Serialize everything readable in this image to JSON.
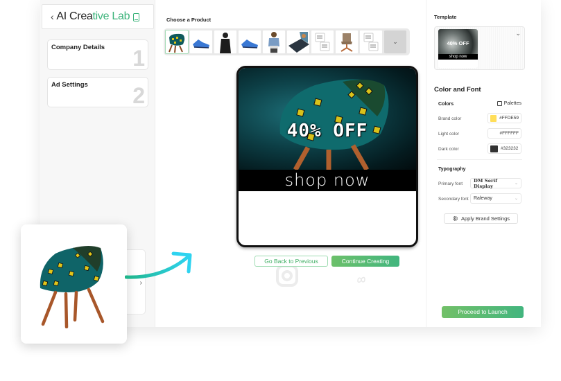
{
  "sidebar": {
    "back_icon": "chevron-left-icon",
    "title_part1": "AI Crea",
    "title_part2": "tive Lab",
    "device_icon": "mobile-device-icon",
    "steps": [
      {
        "label": "Company Details",
        "number": "1"
      },
      {
        "label": "Ad Settings",
        "number": "2"
      }
    ],
    "collapse_icon": "chevron-right-icon",
    "collapse_glyph": "›"
  },
  "product_picker": {
    "label": "Choose a Product",
    "products": [
      {
        "name": "patterned teal armchair",
        "selected": true
      },
      {
        "name": "blue sneaker",
        "selected": false
      },
      {
        "name": "black jacket model",
        "selected": false
      },
      {
        "name": "blue sneaker",
        "selected": false
      },
      {
        "name": "woman with laptop bag",
        "selected": false
      },
      {
        "name": "laptop",
        "selected": false
      },
      {
        "name": "white mugs",
        "selected": false
      },
      {
        "name": "brown swivel chair",
        "selected": false
      },
      {
        "name": "white mugs",
        "selected": false
      }
    ],
    "more_glyph": "⌄"
  },
  "ad_preview": {
    "offer_text": "40% OFF",
    "cta_text": "shop now"
  },
  "actions": {
    "back_label": "Go Back to Previous",
    "continue_label": "Continue Creating",
    "launch_label": "Proceed to Launch"
  },
  "template": {
    "label": "Template",
    "thumb_offer": "40% OFF",
    "thumb_cta": "shop now",
    "chevron_glyph": "⌄"
  },
  "color_font": {
    "title": "Color and Font",
    "colors_label": "Colors",
    "palettes_label": "Palettes",
    "colors": [
      {
        "label": "Brand color",
        "value": "#FFDE59",
        "swatch": "#FFDE59"
      },
      {
        "label": "Light color",
        "value": "#FFFFFF",
        "swatch": "#FFFFFF"
      },
      {
        "label": "Dark color",
        "value": "#323232",
        "swatch": "#323232"
      }
    ],
    "typography_label": "Typography",
    "primary_font_label": "Primary font",
    "primary_font_value": "DM Serif Display",
    "secondary_font_label": "Secondary font",
    "secondary_font_value": "Raleway",
    "apply_label": "Apply Brand Settings",
    "select_glyph": "⌄"
  },
  "accent_colors": {
    "green": "#3bb37a",
    "arrow_start": "#1fb58a",
    "arrow_end": "#2ed3f0"
  }
}
